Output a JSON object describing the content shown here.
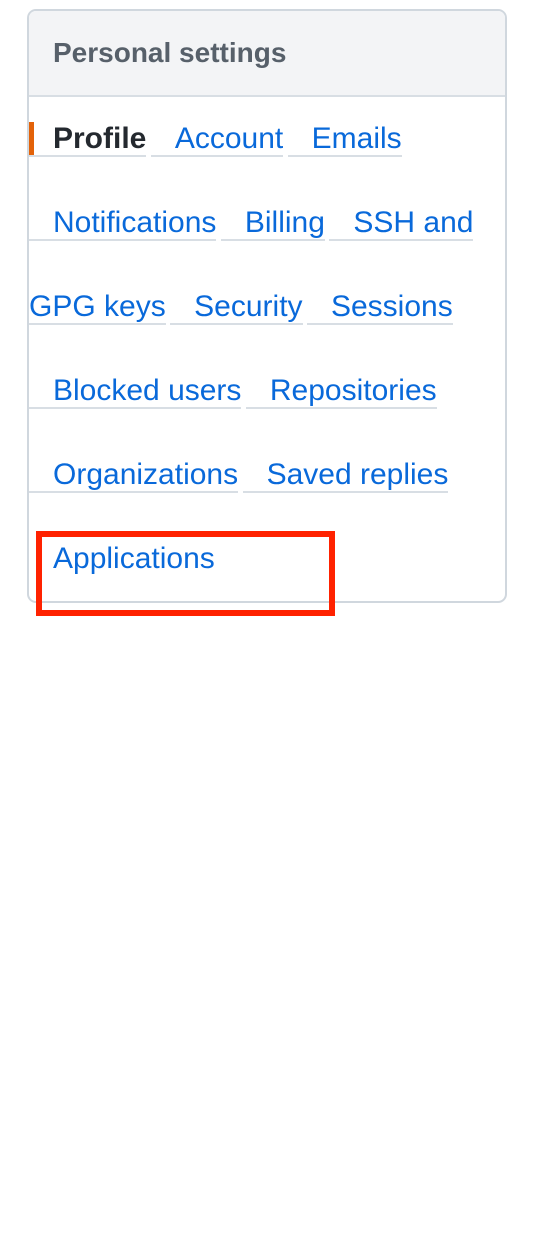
{
  "menu": {
    "header": "Personal settings",
    "items": [
      {
        "label": "Profile",
        "selected": true
      },
      {
        "label": "Account"
      },
      {
        "label": "Emails"
      },
      {
        "label": "Notifications"
      },
      {
        "label": "Billing"
      },
      {
        "label": "SSH and GPG keys",
        "highlighted": true
      },
      {
        "label": "Security"
      },
      {
        "label": "Sessions"
      },
      {
        "label": "Blocked users"
      },
      {
        "label": "Repositories"
      },
      {
        "label": "Organizations"
      },
      {
        "label": "Saved replies"
      },
      {
        "label": "Applications"
      }
    ]
  },
  "colors": {
    "link": "#0969da",
    "selected_indicator": "#e36209",
    "highlight": "#ff2200"
  }
}
